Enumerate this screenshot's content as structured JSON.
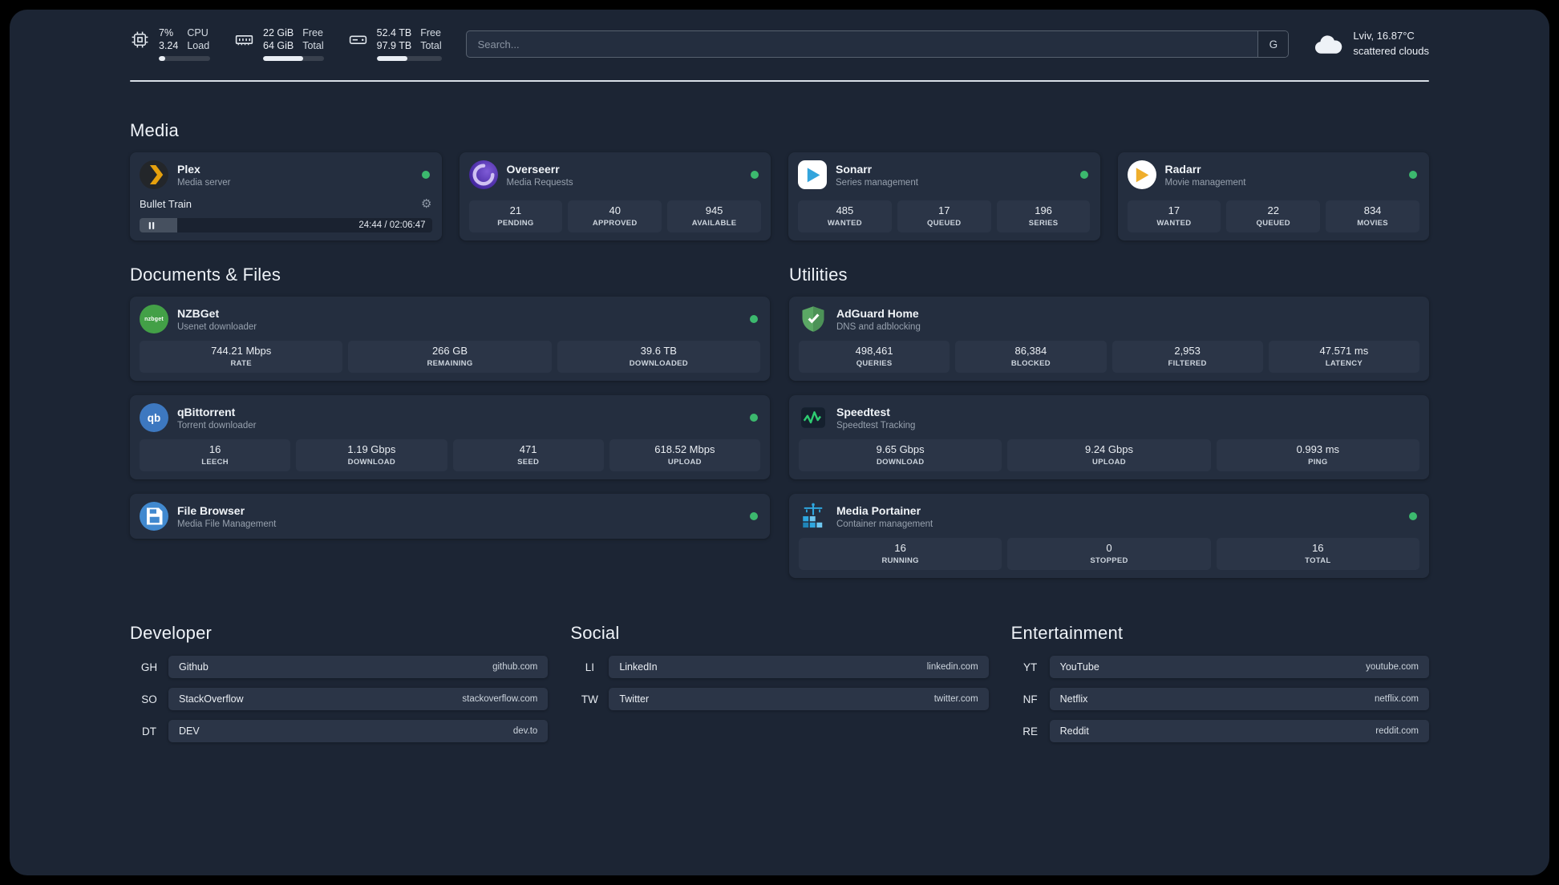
{
  "topbar": {
    "cpu": {
      "value_top": "7%",
      "value_bottom": "3.24",
      "label_top": "CPU",
      "label_bottom": "Load",
      "progress": 12
    },
    "ram": {
      "value_top": "22 GiB",
      "value_bottom": "64 GiB",
      "label_top": "Free",
      "label_bottom": "Total",
      "progress": 66
    },
    "disk": {
      "value_top": "52.4 TB",
      "value_bottom": "97.9 TB",
      "label_top": "Free",
      "label_bottom": "Total",
      "progress": 47
    },
    "search": {
      "placeholder": "Search...",
      "button_label": "G"
    },
    "weather": {
      "location": "Lviv, 16.87°C",
      "condition": "scattered clouds"
    }
  },
  "sections": {
    "media": "Media",
    "documents": "Documents & Files",
    "utilities": "Utilities",
    "developer": "Developer",
    "social": "Social",
    "entertainment": "Entertainment"
  },
  "colors": {
    "status_ok": "#3cb96e",
    "background": "#1c2534",
    "card": "#242e3f",
    "tile": "#2b3547"
  },
  "services": {
    "plex": {
      "name": "Plex",
      "subtitle": "Media server",
      "player": {
        "track": "Bullet Train",
        "time": "24:44 / 02:06:47",
        "progress": 13
      }
    },
    "overseerr": {
      "name": "Overseerr",
      "subtitle": "Media Requests",
      "stats": [
        {
          "value": "21",
          "label": "PENDING"
        },
        {
          "value": "40",
          "label": "APPROVED"
        },
        {
          "value": "945",
          "label": "AVAILABLE"
        }
      ]
    },
    "sonarr": {
      "name": "Sonarr",
      "subtitle": "Series management",
      "stats": [
        {
          "value": "485",
          "label": "WANTED"
        },
        {
          "value": "17",
          "label": "QUEUED"
        },
        {
          "value": "196",
          "label": "SERIES"
        }
      ]
    },
    "radarr": {
      "name": "Radarr",
      "subtitle": "Movie management",
      "stats": [
        {
          "value": "17",
          "label": "WANTED"
        },
        {
          "value": "22",
          "label": "QUEUED"
        },
        {
          "value": "834",
          "label": "MOVIES"
        }
      ]
    },
    "nzbget": {
      "name": "NZBGet",
      "subtitle": "Usenet downloader",
      "stats": [
        {
          "value": "744.21 Mbps",
          "label": "RATE"
        },
        {
          "value": "266 GB",
          "label": "REMAINING"
        },
        {
          "value": "39.6 TB",
          "label": "DOWNLOADED"
        }
      ]
    },
    "qbittorrent": {
      "name": "qBittorrent",
      "subtitle": "Torrent downloader",
      "stats": [
        {
          "value": "16",
          "label": "LEECH"
        },
        {
          "value": "1.19 Gbps",
          "label": "DOWNLOAD"
        },
        {
          "value": "471",
          "label": "SEED"
        },
        {
          "value": "618.52 Mbps",
          "label": "UPLOAD"
        }
      ]
    },
    "filebrowser": {
      "name": "File Browser",
      "subtitle": "Media File Management"
    },
    "adguard": {
      "name": "AdGuard Home",
      "subtitle": "DNS and adblocking",
      "stats": [
        {
          "value": "498,461",
          "label": "QUERIES"
        },
        {
          "value": "86,384",
          "label": "BLOCKED"
        },
        {
          "value": "2,953",
          "label": "FILTERED"
        },
        {
          "value": "47.571 ms",
          "label": "LATENCY"
        }
      ]
    },
    "speedtest": {
      "name": "Speedtest",
      "subtitle": "Speedtest Tracking",
      "stats": [
        {
          "value": "9.65 Gbps",
          "label": "DOWNLOAD"
        },
        {
          "value": "9.24 Gbps",
          "label": "UPLOAD"
        },
        {
          "value": "0.993 ms",
          "label": "PING"
        }
      ]
    },
    "portainer": {
      "name": "Media Portainer",
      "subtitle": "Container management",
      "stats": [
        {
          "value": "16",
          "label": "RUNNING"
        },
        {
          "value": "0",
          "label": "STOPPED"
        },
        {
          "value": "16",
          "label": "TOTAL"
        }
      ]
    }
  },
  "bookmarks": {
    "developer": [
      {
        "abbr": "GH",
        "name": "Github",
        "domain": "github.com"
      },
      {
        "abbr": "SO",
        "name": "StackOverflow",
        "domain": "stackoverflow.com"
      },
      {
        "abbr": "DT",
        "name": "DEV",
        "domain": "dev.to"
      }
    ],
    "social": [
      {
        "abbr": "LI",
        "name": "LinkedIn",
        "domain": "linkedin.com"
      },
      {
        "abbr": "TW",
        "name": "Twitter",
        "domain": "twitter.com"
      }
    ],
    "entertainment": [
      {
        "abbr": "YT",
        "name": "YouTube",
        "domain": "youtube.com"
      },
      {
        "abbr": "NF",
        "name": "Netflix",
        "domain": "netflix.com"
      },
      {
        "abbr": "RE",
        "name": "Reddit",
        "domain": "reddit.com"
      }
    ]
  }
}
